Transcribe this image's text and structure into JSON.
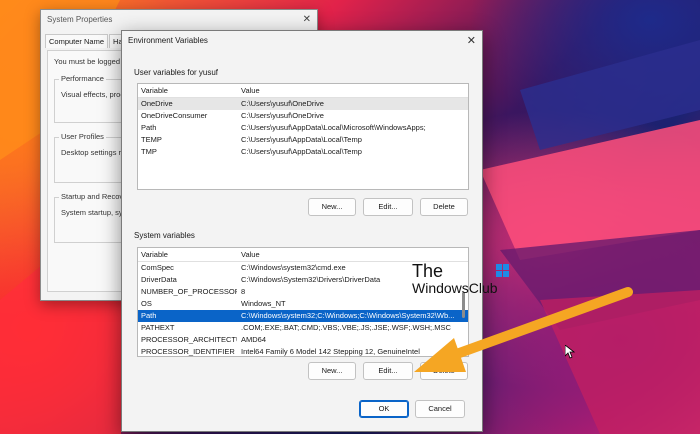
{
  "system_properties": {
    "title": "System Properties",
    "tabs": [
      "Computer Name",
      "Hardw"
    ],
    "logged_on_text": "You must be logged o",
    "groups": [
      {
        "label": "Performance",
        "text": "Visual effects, proces"
      },
      {
        "label": "User Profiles",
        "text": "Desktop settings rela"
      },
      {
        "label": "Startup and Recovery",
        "text": "System startup, syste"
      }
    ]
  },
  "env_vars": {
    "title": "Environment Variables",
    "user_section": {
      "label": "User variables for yusuf",
      "headers": [
        "Variable",
        "Value"
      ],
      "rows": [
        {
          "variable": "OneDrive",
          "value": "C:\\Users\\yusuf\\OneDrive"
        },
        {
          "variable": "OneDriveConsumer",
          "value": "C:\\Users\\yusuf\\OneDrive"
        },
        {
          "variable": "Path",
          "value": "C:\\Users\\yusuf\\AppData\\Local\\Microsoft\\WindowsApps;"
        },
        {
          "variable": "TEMP",
          "value": "C:\\Users\\yusuf\\AppData\\Local\\Temp"
        },
        {
          "variable": "TMP",
          "value": "C:\\Users\\yusuf\\AppData\\Local\\Temp"
        }
      ],
      "buttons": {
        "new": "New...",
        "edit": "Edit...",
        "delete": "Delete"
      }
    },
    "system_section": {
      "label": "System variables",
      "headers": [
        "Variable",
        "Value"
      ],
      "rows": [
        {
          "variable": "ComSpec",
          "value": "C:\\Windows\\system32\\cmd.exe"
        },
        {
          "variable": "DriverData",
          "value": "C:\\Windows\\System32\\Drivers\\DriverData"
        },
        {
          "variable": "NUMBER_OF_PROCESSORS",
          "value": "8"
        },
        {
          "variable": "OS",
          "value": "Windows_NT"
        },
        {
          "variable": "Path",
          "value": "C:\\Windows\\system32;C:\\Windows;C:\\Windows\\System32\\Wb..."
        },
        {
          "variable": "PATHEXT",
          "value": ".COM;.EXE;.BAT;.CMD;.VBS;.VBE;.JS;.JSE;.WSF;.WSH;.MSC"
        },
        {
          "variable": "PROCESSOR_ARCHITECTU...",
          "value": "AMD64"
        },
        {
          "variable": "PROCESSOR_IDENTIFIER",
          "value": "Intel64 Family 6 Model 142 Stepping 12, GenuineIntel"
        }
      ],
      "selected_index": 4,
      "buttons": {
        "new": "New...",
        "edit": "Edit...",
        "delete": "Delete"
      }
    },
    "footer": {
      "ok": "OK",
      "cancel": "Cancel"
    }
  },
  "watermark": {
    "line1": "The",
    "line2": "WindowsClub"
  },
  "colors": {
    "selection": "#0a64c8",
    "arrow": "#f5a623",
    "window_bg": "#f3f3f3"
  }
}
